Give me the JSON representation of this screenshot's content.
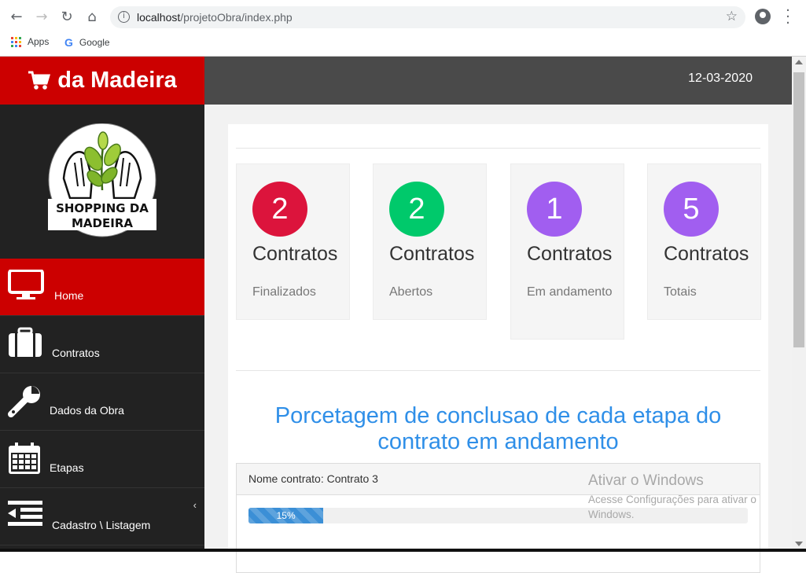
{
  "browser": {
    "url_host": "localhost",
    "url_path": "/projetoObra/index.php",
    "bookmarks": [
      {
        "label": "Apps",
        "icon": "apps-grid-icon"
      },
      {
        "label": "Google",
        "icon": "google-icon"
      }
    ]
  },
  "brand": {
    "name": "da Madeira",
    "icon": "shopping-cart-icon"
  },
  "logo": {
    "line1": "SHOPPING DA",
    "line2": "MADEIRA"
  },
  "sidebar": {
    "items": [
      {
        "label": "Home",
        "icon": "monitor-icon",
        "active": true
      },
      {
        "label": "Contratos",
        "icon": "briefcase-icon"
      },
      {
        "label": "Dados da Obra",
        "icon": "wrench-icon"
      },
      {
        "label": "Etapas",
        "icon": "calendar-icon"
      },
      {
        "label": "Cadastro \\ Listagem",
        "icon": "list-indent-icon",
        "chevron": "‹"
      }
    ]
  },
  "topbar": {
    "date": "12-03-2020"
  },
  "stats": [
    {
      "count": "2",
      "title": "Contratos",
      "subtitle": "Finalizados",
      "color": "#dc143c"
    },
    {
      "count": "2",
      "title": "Contratos",
      "subtitle": "Abertos",
      "color": "#00c96b"
    },
    {
      "count": "1",
      "title": "Contratos",
      "subtitle": "Em andamento",
      "color": "#a15ef0"
    },
    {
      "count": "5",
      "title": "Contratos",
      "subtitle": "Totais",
      "color": "#a15ef0"
    }
  ],
  "section": {
    "title": "Porcetagem de conclusao de cada etapa do contrato em andamento"
  },
  "contract": {
    "name": "Nome contrato: Contrato 3",
    "progress_percent": 15,
    "progress_label": "15%"
  },
  "watermark": {
    "title": "Ativar o Windows",
    "text": "Acesse Configurações para ativar o Windows."
  },
  "colors": {
    "brand_red": "#cc0000",
    "sidebar_bg": "#222222",
    "topbar_bg": "#4a4a4a",
    "accent_blue": "#2f8fe8",
    "progress_blue": "#3b8fd6"
  }
}
